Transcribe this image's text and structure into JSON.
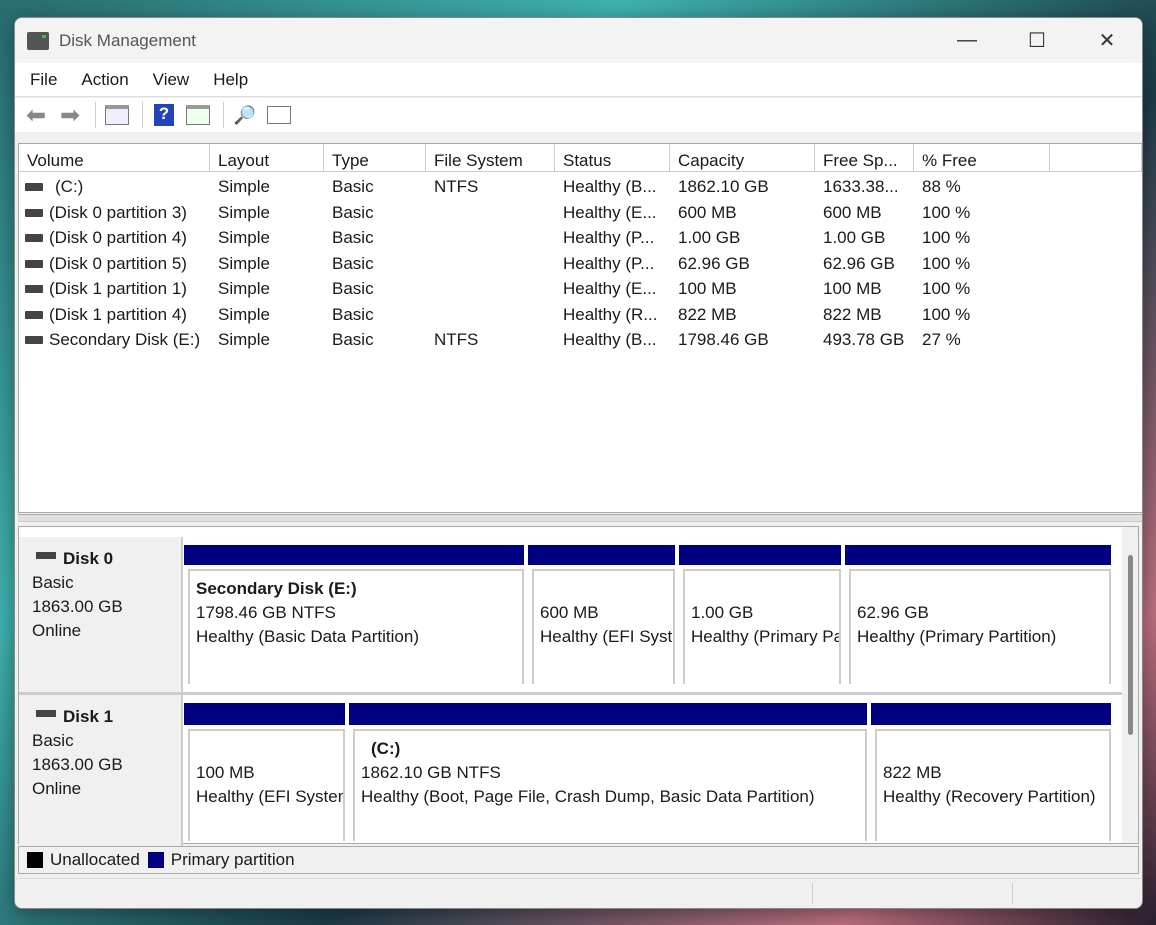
{
  "window": {
    "title": "Disk Management",
    "controls": {
      "minimize": "—",
      "maximize": "☐",
      "close": "✕"
    }
  },
  "menu": [
    "File",
    "Action",
    "View",
    "Help"
  ],
  "toolbar": [
    "back-icon",
    "forward-icon",
    "show-hide-console-tree-icon",
    "help-icon",
    "show-hide-action-pane-icon",
    "rescan-disks-icon",
    "properties-icon"
  ],
  "table": {
    "columns": [
      "Volume",
      "Layout",
      "Type",
      "File System",
      "Status",
      "Capacity",
      "Free Sp...",
      "% Free"
    ],
    "rows": [
      [
        "(C:)",
        "Simple",
        "Basic",
        "NTFS",
        "Healthy (B...",
        "1862.10 GB",
        "1633.38...",
        "88 %"
      ],
      [
        "(Disk 0 partition 3)",
        "Simple",
        "Basic",
        "",
        "Healthy (E...",
        "600 MB",
        "600 MB",
        "100 %"
      ],
      [
        "(Disk 0 partition 4)",
        "Simple",
        "Basic",
        "",
        "Healthy (P...",
        "1.00 GB",
        "1.00 GB",
        "100 %"
      ],
      [
        "(Disk 0 partition 5)",
        "Simple",
        "Basic",
        "",
        "Healthy (P...",
        "62.96 GB",
        "62.96 GB",
        "100 %"
      ],
      [
        "(Disk 1 partition 1)",
        "Simple",
        "Basic",
        "",
        "Healthy (E...",
        "100 MB",
        "100 MB",
        "100 %"
      ],
      [
        "(Disk 1 partition 4)",
        "Simple",
        "Basic",
        "",
        "Healthy (R...",
        "822 MB",
        "822 MB",
        "100 %"
      ],
      [
        "Secondary Disk (E:)",
        "Simple",
        "Basic",
        "NTFS",
        "Healthy (B...",
        "1798.46 GB",
        "493.78 GB",
        "27 %"
      ]
    ]
  },
  "disks": [
    {
      "name": "Disk 0",
      "type": "Basic",
      "size": "1863.00 GB",
      "state": "Online",
      "partitions": [
        {
          "title": "Secondary Disk  (E:)",
          "size": "1798.46 GB NTFS",
          "status": "Healthy (Basic Data Partition)"
        },
        {
          "title": "",
          "size": "600 MB",
          "status": "Healthy (EFI System Partition)"
        },
        {
          "title": "",
          "size": "1.00 GB",
          "status": "Healthy (Primary Partition)"
        },
        {
          "title": "",
          "size": "62.96 GB",
          "status": "Healthy (Primary Partition)"
        }
      ]
    },
    {
      "name": "Disk 1",
      "type": "Basic",
      "size": "1863.00 GB",
      "state": "Online",
      "partitions": [
        {
          "title": "",
          "size": "100 MB",
          "status": "Healthy (EFI System Partition)"
        },
        {
          "title": "(C:)",
          "size": "1862.10 GB NTFS",
          "status": "Healthy (Boot, Page File, Crash Dump, Basic Data Partition)"
        },
        {
          "title": "",
          "size": "822 MB",
          "status": "Healthy (Recovery Partition)"
        }
      ]
    }
  ],
  "legend": [
    {
      "label": "Unallocated",
      "color": "#000000"
    },
    {
      "label": "Primary partition",
      "color": "#000080"
    }
  ]
}
